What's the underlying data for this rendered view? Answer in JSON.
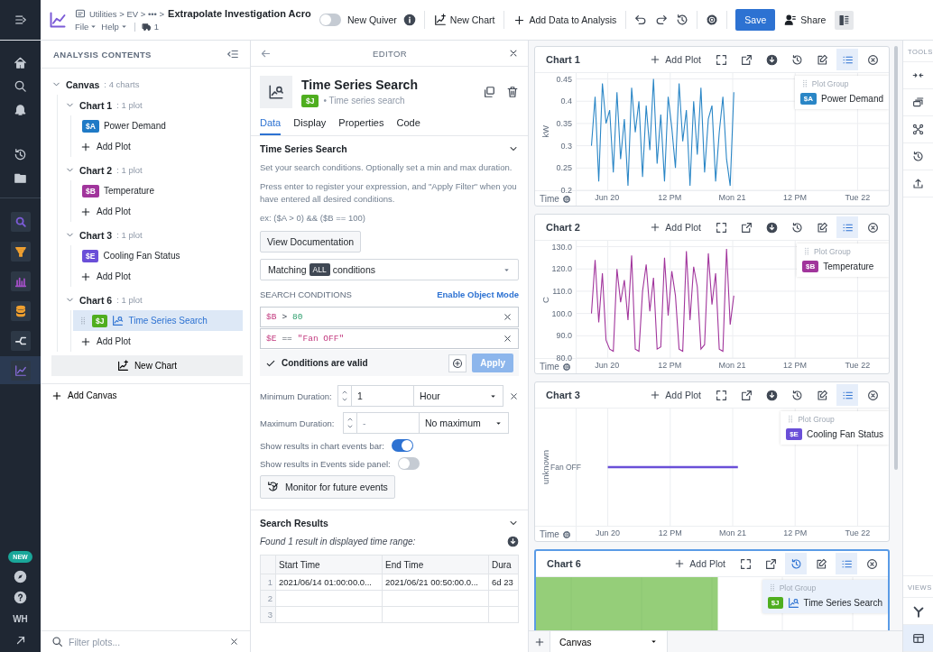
{
  "top_bar": {
    "breadcrumb": "Utilities > EV > ••• >",
    "title": "Extrapolate Investigation Acro",
    "menus": [
      "File",
      "Help"
    ],
    "badge_count": "1",
    "quiver_toggle": {
      "label": "New Quiver",
      "on": false
    },
    "actions": [
      {
        "kind": "new-chart",
        "label": "New Chart"
      },
      {
        "kind": "add",
        "label": "Add Data to Analysis"
      }
    ],
    "save": "Save",
    "share": "Share"
  },
  "rail": {
    "top_items": [
      {
        "kind": "home",
        "selected": false
      },
      {
        "kind": "search",
        "selected": false
      },
      {
        "kind": "bell",
        "selected": false
      },
      {
        "kind": "history",
        "selected": false
      },
      {
        "kind": "folder",
        "selected": false
      }
    ],
    "app_items": [
      {
        "kind": "search-app",
        "selected": false
      },
      {
        "kind": "filter",
        "selected": false
      },
      {
        "kind": "bar-chart",
        "selected": false
      },
      {
        "kind": "database",
        "selected": false
      },
      {
        "kind": "graph",
        "selected": false
      },
      {
        "kind": "line-chart",
        "selected": true
      }
    ],
    "bottom_items": [
      {
        "kind": "badge",
        "label": "NEW"
      },
      {
        "kind": "compass"
      },
      {
        "kind": "help"
      },
      {
        "kind": "avatar",
        "label": "WH"
      },
      {
        "kind": "collapse"
      }
    ]
  },
  "contents": {
    "title": "ANALYSIS CONTENTS",
    "tree": [
      {
        "kind": "canvas",
        "label": "Canvas",
        "count": ": 4 charts",
        "expanded": true,
        "children": [
          {
            "kind": "chart",
            "label": "Chart 1",
            "count": ": 1 plot",
            "expanded": true,
            "children": [
              {
                "kind": "plot",
                "tag": "$A",
                "color": "#1f7ac6",
                "label": "Power Demand",
                "selected": false
              },
              {
                "kind": "add",
                "label": "Add Plot"
              }
            ]
          },
          {
            "kind": "chart",
            "label": "Chart 2",
            "count": ": 1 plot",
            "expanded": true,
            "children": [
              {
                "kind": "plot",
                "tag": "$B",
                "color": "#a1359c",
                "label": "Temperature",
                "selected": false
              },
              {
                "kind": "add",
                "label": "Add Plot"
              }
            ]
          },
          {
            "kind": "chart",
            "label": "Chart 3",
            "count": ": 1 plot",
            "expanded": true,
            "children": [
              {
                "kind": "plot",
                "tag": "$E",
                "color": "#6a4fd8",
                "label": "Cooling Fan Status",
                "selected": false
              },
              {
                "kind": "add",
                "label": "Add Plot"
              }
            ]
          },
          {
            "kind": "chart",
            "label": "Chart 6",
            "count": ": 1 plot",
            "expanded": true,
            "children": [
              {
                "kind": "search-plot",
                "tag": "$J",
                "color": "#4fae1f",
                "label": "Time Series Search",
                "selected": true
              },
              {
                "kind": "add",
                "label": "Add Plot"
              }
            ]
          }
        ]
      }
    ],
    "new_chart": "New Chart",
    "add_canvas": "Add Canvas",
    "filter_placeholder": "Filter plots..."
  },
  "editor": {
    "header": "EDITOR",
    "title": "Time Series Search",
    "tag": "$J",
    "subtitle": "• Time series search",
    "tabs": [
      {
        "label": "Data",
        "selected": true
      },
      {
        "label": "Display",
        "selected": false
      },
      {
        "label": "Properties",
        "selected": false
      },
      {
        "label": "Code",
        "selected": false
      }
    ],
    "search": {
      "title": "Time Series Search",
      "expanded": true,
      "notes": [
        "Set your search conditions. Optionally set a min and max duration.",
        "Press enter to register your expression, and \"Apply Filter\" when you have entered all desired conditions.",
        "ex: ($A > 0) && ($B == 100)"
      ],
      "doc_button": "View Documentation",
      "matching": {
        "prefix": "Matching",
        "value": "ALL",
        "suffix": "conditions"
      },
      "conditions_title": "SEARCH CONDITIONS",
      "object_mode_link": "Enable Object Mode",
      "conditions": [
        {
          "variable": "$B",
          "operator": ">",
          "value": "80",
          "kind": "number"
        },
        {
          "variable": "$E",
          "operator": "==",
          "value": "\"Fan OFF\"",
          "kind": "string"
        }
      ],
      "validity": {
        "text": "Conditions are valid",
        "valid": true
      },
      "apply": {
        "label": "Apply",
        "disabled": true
      },
      "min_duration": {
        "label": "Minimum Duration:",
        "value": "1",
        "unit": "Hour",
        "clearable": true
      },
      "max_duration": {
        "label": "Maximum Duration:",
        "placeholder": "-",
        "unit": "No maximum",
        "clearable": false
      },
      "toggles": [
        {
          "label": "Show results in chart events bar:",
          "on": true
        },
        {
          "label": "Show results in Events side panel:",
          "on": false
        }
      ],
      "monitor_button": "Monitor for future events"
    },
    "results": {
      "title": "Search Results",
      "expanded": true,
      "summary": "Found 1 result in displayed time range:",
      "columns": [
        "Start Time",
        "End Time",
        "Dura"
      ],
      "rows": [
        {
          "index": "1",
          "cells": [
            "2021/06/14 01:00:00.0...",
            "2021/06/21 00:50:00.0...",
            "6d 23"
          ]
        },
        {
          "index": "2"
        },
        {
          "index": "3"
        }
      ]
    }
  },
  "charts": [
    {
      "title": "Chart 1",
      "selected": false,
      "add_plot": "Add Plot",
      "kind": "wave",
      "tools": [
        {
          "kind": "expand",
          "active": false
        },
        {
          "kind": "export",
          "active": false
        },
        {
          "kind": "download",
          "active": false
        },
        {
          "kind": "history",
          "active": false
        },
        {
          "kind": "edit",
          "active": false
        },
        {
          "kind": "list",
          "active": true
        },
        {
          "kind": "close",
          "active": false
        }
      ],
      "x_axis_label": "Time",
      "legend": {
        "header": "Plot Group",
        "tag": "$A",
        "kind": "series"
      },
      "chart_data": {
        "type": "line",
        "grid": true,
        "ylabel": "kW",
        "xlim": [
          "2021-06-19T10:00",
          "2021-06-22T06:00"
        ],
        "ylim": [
          0.2,
          0.524
        ],
        "xticks": [
          {
            "value": "2021-06-20T00:00",
            "label": "Jun 20"
          },
          {
            "value": "2021-06-20T12:00",
            "label": "12 PM"
          },
          {
            "value": "2021-06-21T00:00",
            "label": "Mon 21"
          },
          {
            "value": "2021-06-21T12:00",
            "label": "12 PM"
          },
          {
            "value": "2021-06-22T00:00",
            "label": "Tue 22"
          }
        ],
        "yticks": [
          {
            "value": 0.45,
            "label": "0.45"
          },
          {
            "value": 0.4,
            "label": "0.4"
          },
          {
            "value": 0.35,
            "label": "0.35"
          },
          {
            "value": 0.3,
            "label": "0.3"
          },
          {
            "value": 0.25,
            "label": "0.25"
          },
          {
            "value": 0.2,
            "label": "0.2"
          }
        ],
        "x": [
          "2021-06-19T21:00",
          "2021-06-19T21:42",
          "2021-06-19T22:24",
          "2021-06-19T23:06",
          "2021-06-19T23:48",
          "2021-06-20T00:30",
          "2021-06-20T01:12",
          "2021-06-20T01:54",
          "2021-06-20T02:36",
          "2021-06-20T03:18",
          "2021-06-20T04:00",
          "2021-06-20T04:42",
          "2021-06-20T05:24",
          "2021-06-20T06:06",
          "2021-06-20T06:48",
          "2021-06-20T07:30",
          "2021-06-20T08:12",
          "2021-06-20T08:54",
          "2021-06-20T09:36",
          "2021-06-20T10:18",
          "2021-06-20T11:00",
          "2021-06-20T11:42",
          "2021-06-20T12:24",
          "2021-06-20T13:06",
          "2021-06-20T13:48",
          "2021-06-20T14:30",
          "2021-06-20T15:12",
          "2021-06-20T15:54",
          "2021-06-20T16:36",
          "2021-06-20T17:18",
          "2021-06-20T18:00",
          "2021-06-20T18:42",
          "2021-06-20T19:24",
          "2021-06-20T20:06",
          "2021-06-20T20:48",
          "2021-06-20T21:30",
          "2021-06-20T22:12",
          "2021-06-20T22:54",
          "2021-06-20T23:36",
          "2021-06-21T00:18"
        ],
        "series": [
          {
            "name": "Power Demand",
            "color": "#2a86c6",
            "values": [
              0.3,
              0.41,
              0.22,
              0.44,
              0.35,
              0.38,
              0.24,
              0.42,
              0.27,
              0.36,
              0.21,
              0.43,
              0.33,
              0.4,
              0.23,
              0.39,
              0.29,
              0.45,
              0.26,
              0.37,
              0.22,
              0.41,
              0.34,
              0.25,
              0.44,
              0.31,
              0.38,
              0.21,
              0.4,
              0.28,
              0.43,
              0.24,
              0.36,
              0.39,
              0.22,
              0.33,
              0.41,
              0.27,
              0.21,
              0.42
            ]
          }
        ]
      }
    },
    {
      "title": "Chart 2",
      "selected": false,
      "add_plot": "Add Plot",
      "kind": "wave",
      "tools": [
        {
          "kind": "expand",
          "active": false
        },
        {
          "kind": "export",
          "active": false
        },
        {
          "kind": "download",
          "active": false
        },
        {
          "kind": "history",
          "active": false
        },
        {
          "kind": "edit",
          "active": false
        },
        {
          "kind": "list",
          "active": true
        },
        {
          "kind": "close",
          "active": false
        }
      ],
      "x_axis_label": "Time",
      "legend": {
        "header": "Plot Group",
        "tag": "$B",
        "kind": "series"
      },
      "chart_data": {
        "type": "line",
        "grid": true,
        "ylabel": "C",
        "xlim": [
          "2021-06-19T10:00",
          "2021-06-22T06:00"
        ],
        "ylim": [
          80,
          144.8
        ],
        "xticks": [
          {
            "value": "2021-06-20T00:00",
            "label": "Jun 20"
          },
          {
            "value": "2021-06-20T12:00",
            "label": "12 PM"
          },
          {
            "value": "2021-06-21T00:00",
            "label": "Mon 21"
          },
          {
            "value": "2021-06-21T12:00",
            "label": "12 PM"
          },
          {
            "value": "2021-06-22T00:00",
            "label": "Tue 22"
          }
        ],
        "yticks": [
          {
            "value": 130,
            "label": "130.0"
          },
          {
            "value": 120,
            "label": "120.0"
          },
          {
            "value": 110,
            "label": "110.0"
          },
          {
            "value": 100,
            "label": "100.0"
          },
          {
            "value": 90,
            "label": "90.0"
          },
          {
            "value": 80,
            "label": "80.0"
          }
        ],
        "x": [
          "2021-06-19T21:00",
          "2021-06-19T21:42",
          "2021-06-19T22:24",
          "2021-06-19T23:06",
          "2021-06-19T23:48",
          "2021-06-20T00:30",
          "2021-06-20T01:12",
          "2021-06-20T01:54",
          "2021-06-20T02:36",
          "2021-06-20T03:18",
          "2021-06-20T04:00",
          "2021-06-20T04:42",
          "2021-06-20T05:24",
          "2021-06-20T06:06",
          "2021-06-20T06:48",
          "2021-06-20T07:30",
          "2021-06-20T08:12",
          "2021-06-20T08:54",
          "2021-06-20T09:36",
          "2021-06-20T10:18",
          "2021-06-20T11:00",
          "2021-06-20T11:42",
          "2021-06-20T12:24",
          "2021-06-20T13:06",
          "2021-06-20T13:48",
          "2021-06-20T14:30",
          "2021-06-20T15:12",
          "2021-06-20T15:54",
          "2021-06-20T16:36",
          "2021-06-20T17:18",
          "2021-06-20T18:00",
          "2021-06-20T18:42",
          "2021-06-20T19:24",
          "2021-06-20T20:06",
          "2021-06-20T20:48",
          "2021-06-20T21:30",
          "2021-06-20T22:12",
          "2021-06-20T22:54",
          "2021-06-20T23:36",
          "2021-06-21T00:18"
        ],
        "series": [
          {
            "name": "Temperature",
            "color": "#a1359c",
            "values": [
              100,
              124,
              96,
              118,
              88,
              84,
              83,
              120,
              105,
              115,
              97,
              126,
              84,
              83,
              110,
              122,
              101,
              116,
              84,
              85,
              125,
              99,
              119,
              108,
              84,
              83,
              128,
              97,
              121,
              112,
              84,
              86,
              127,
              104,
              118,
              84,
              83,
              129,
              95,
              108
            ]
          }
        ]
      }
    },
    {
      "title": "Chart 3",
      "selected": false,
      "add_plot": "Add Plot",
      "kind": "state",
      "color": "#6a4fd8",
      "tools": [
        {
          "kind": "expand",
          "active": false
        },
        {
          "kind": "export",
          "active": false
        },
        {
          "kind": "download",
          "active": false
        },
        {
          "kind": "history",
          "active": false
        },
        {
          "kind": "edit",
          "active": false
        },
        {
          "kind": "list",
          "active": true
        },
        {
          "kind": "close",
          "active": false
        }
      ],
      "y_label": "unknown",
      "state_label": "Fan OFF",
      "x_axis_label": "Time",
      "x_ticks": [
        "Jun 20",
        "12 PM",
        "Mon 21",
        "12 PM",
        "Tue 22"
      ],
      "legend": {
        "header": "Plot Group",
        "tag": "$E",
        "label": "Cooling Fan Status",
        "kind": "series"
      }
    },
    {
      "title": "Chart 6",
      "selected": true,
      "add_plot": "Add Plot",
      "kind": "events",
      "color": "#4fae1f",
      "tools": [
        {
          "kind": "expand",
          "active": false
        },
        {
          "kind": "export",
          "active": false
        },
        {
          "kind": "history",
          "active": true
        },
        {
          "kind": "edit",
          "active": false
        },
        {
          "kind": "list",
          "active": true
        },
        {
          "kind": "close",
          "active": false
        }
      ],
      "legend": {
        "header": "Plot Group",
        "tag": "$J",
        "label": "Time Series Search",
        "kind": "search"
      }
    }
  ],
  "canvas_tab": {
    "label": "Canvas"
  },
  "tools_rail": {
    "title": "TOOLS",
    "tools": [
      {
        "kind": "swap"
      },
      {
        "kind": "layers"
      },
      {
        "kind": "nodes"
      },
      {
        "kind": "history"
      },
      {
        "kind": "upload"
      }
    ],
    "views_title": "VIEWS",
    "views": [
      {
        "kind": "branch",
        "selected": false
      },
      {
        "kind": "layout",
        "selected": true
      }
    ]
  }
}
